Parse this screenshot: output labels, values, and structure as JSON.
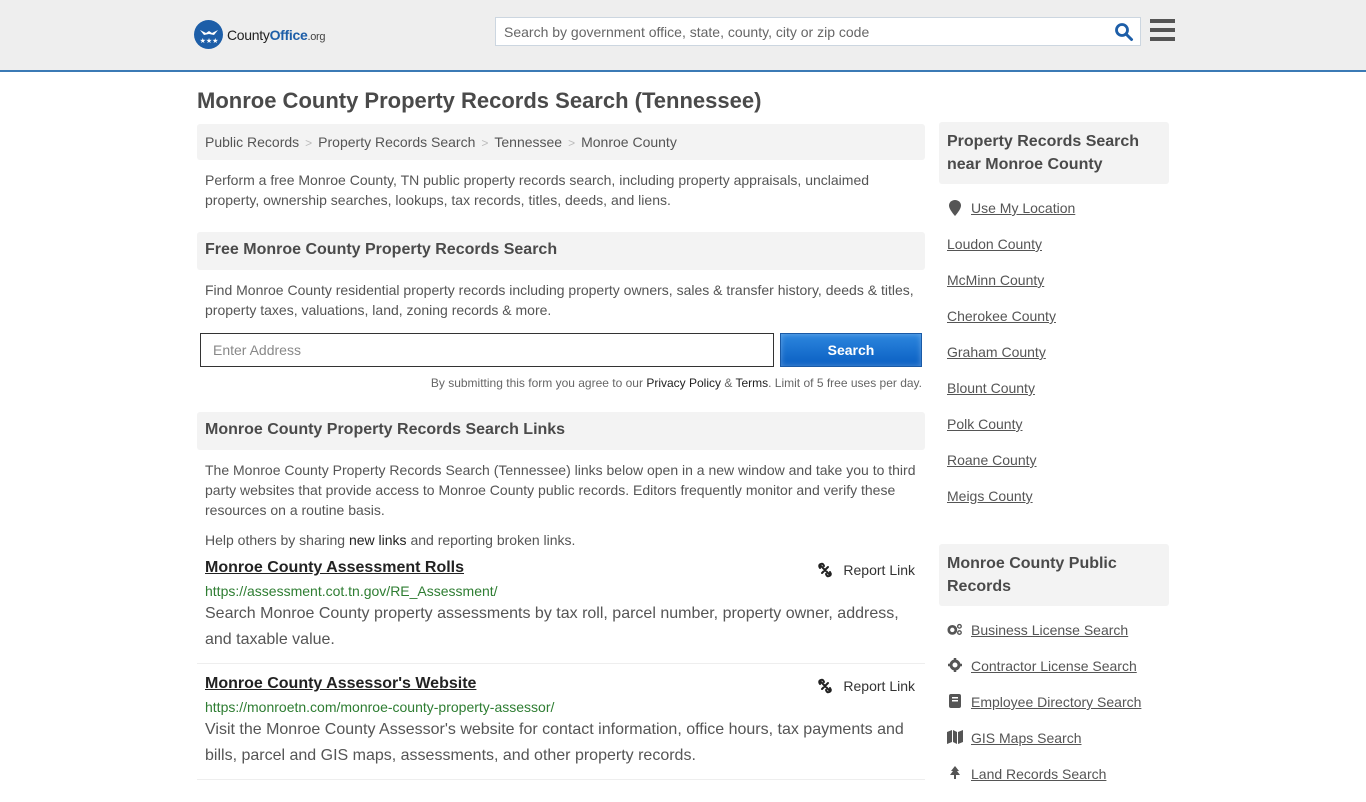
{
  "header": {
    "logo": {
      "name": "County",
      "highlight": "Office",
      "tld": ".org"
    },
    "search_placeholder": "Search by government office, state, county, city or zip code"
  },
  "page_title": "Monroe County Property Records Search (Tennessee)",
  "breadcrumb": [
    "Public Records",
    "Property Records Search",
    "Tennessee",
    "Monroe County"
  ],
  "intro": "Perform a free Monroe County, TN public property records search, including property appraisals, unclaimed property, ownership searches, lookups, tax records, titles, deeds, and liens.",
  "free_search": {
    "heading": "Free Monroe County Property Records Search",
    "description": "Find Monroe County residential property records including property owners, sales & transfer history, deeds & titles, property taxes, valuations, land, zoning records & more.",
    "address_placeholder": "Enter Address",
    "button_label": "Search",
    "disclaimer_prefix": "By submitting this form you agree to our ",
    "privacy_label": "Privacy Policy",
    "amp": " & ",
    "terms_label": "Terms",
    "disclaimer_suffix": ". Limit of 5 free uses per day."
  },
  "links_section": {
    "heading": "Monroe County Property Records Search Links",
    "description": "The Monroe County Property Records Search (Tennessee) links below open in a new window and take you to third party websites that provide access to Monroe County public records. Editors frequently monitor and verify these resources on a routine basis.",
    "help_prefix": "Help others by sharing ",
    "help_link": "new links",
    "help_suffix": " and reporting broken links.",
    "report_label": "Report Link",
    "items": [
      {
        "title": "Monroe County Assessment Rolls",
        "url": "https://assessment.cot.tn.gov/RE_Assessment/",
        "description": "Search Monroe County property assessments by tax roll, parcel number, property owner, address, and taxable value."
      },
      {
        "title": "Monroe County Assessor's Website",
        "url": "https://monroetn.com/monroe-county-property-assessor/",
        "description": "Visit the Monroe County Assessor's website for contact information, office hours, tax payments and bills, parcel and GIS maps, assessments, and other property records."
      }
    ]
  },
  "sidebar": {
    "nearby": {
      "heading": "Property Records Search near Monroe County",
      "use_location": "Use My Location",
      "counties": [
        "Loudon County",
        "McMinn County",
        "Cherokee County",
        "Graham County",
        "Blount County",
        "Polk County",
        "Roane County",
        "Meigs County"
      ]
    },
    "public_records": {
      "heading": "Monroe County Public Records",
      "items": [
        {
          "label": "Business License Search",
          "icon": "gears-icon"
        },
        {
          "label": "Contractor License Search",
          "icon": "gear-icon"
        },
        {
          "label": "Employee Directory Search",
          "icon": "book-icon"
        },
        {
          "label": "GIS Maps Search",
          "icon": "map-icon"
        },
        {
          "label": "Land Records Search",
          "icon": "tree-icon"
        }
      ]
    }
  }
}
